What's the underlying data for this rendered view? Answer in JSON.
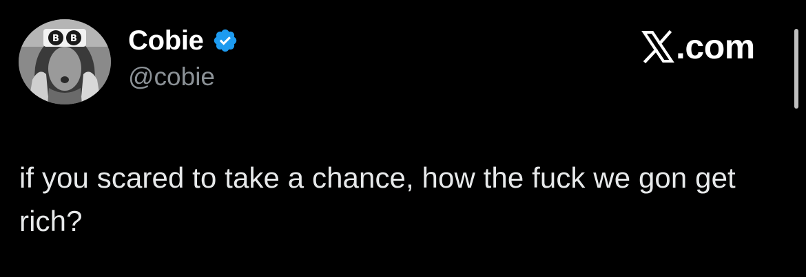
{
  "author": {
    "display_name": "Cobie",
    "handle": "@cobie",
    "verified": true,
    "avatar_icon": "avatar-photo-icon",
    "verified_badge_color": "#1d9bf0"
  },
  "brand": {
    "logo_icon": "x-logo-icon",
    "domain": ".com"
  },
  "tweet": {
    "text": "if you scared to take a chance, how the fuck we gon get rich?"
  },
  "colors": {
    "background": "#000000",
    "name": "#ffffff",
    "handle": "#8b9196",
    "body_text": "#e7e9ea"
  }
}
